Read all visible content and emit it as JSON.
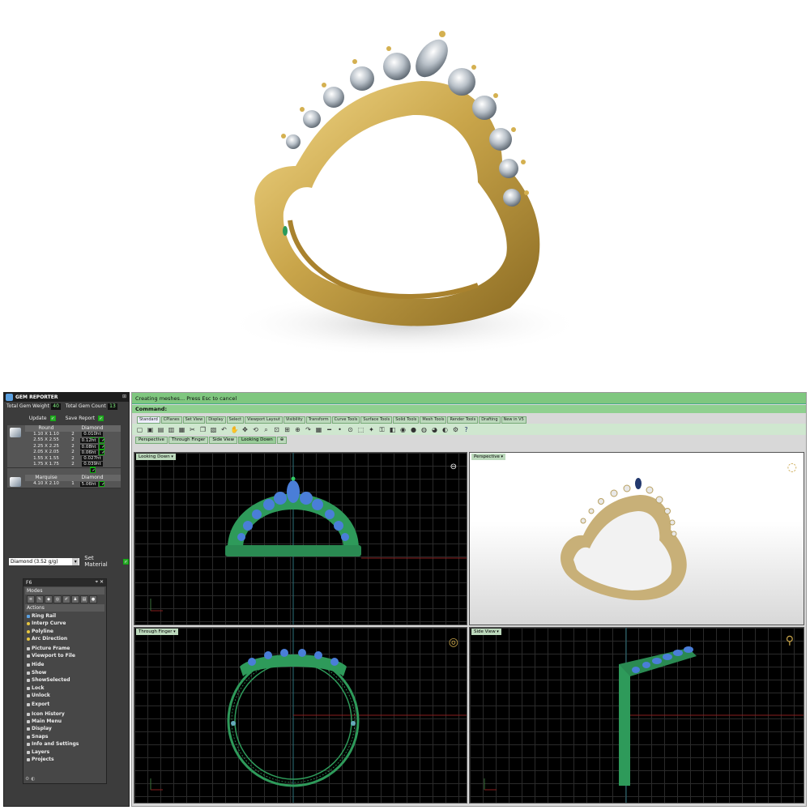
{
  "gem_reporter": {
    "title": "GEM REPORTER",
    "total_weight_label": "Total Gem Weight",
    "total_weight": "40",
    "total_count_label": "Total Gem Count",
    "total_count": "13",
    "update_label": "Update",
    "save_report_label": "Save Report",
    "groups": [
      {
        "shape": "Round",
        "material": "Diamond",
        "rows": [
          {
            "size": "1.10 X 1.10",
            "qty": "2",
            "weight": "0.010ht"
          },
          {
            "size": "2.55 X 2.55",
            "qty": "2",
            "weight": "0.12ht"
          },
          {
            "size": "2.25 X 2.25",
            "qty": "2",
            "weight": "0.08ht"
          },
          {
            "size": "2.05 X 2.05",
            "qty": "2",
            "weight": "0.06ht"
          },
          {
            "size": "1.55 X 1.55",
            "qty": "2",
            "weight": "0.027ht"
          },
          {
            "size": "1.75 X 1.75",
            "qty": "2",
            "weight": "0.039ht"
          }
        ]
      },
      {
        "shape": "Marquise",
        "material": "Diamond",
        "rows": [
          {
            "size": "4.10 X 2.10",
            "qty": "1",
            "weight": "5.06ht"
          }
        ]
      }
    ],
    "material_select": "Diamond  (3.52 g/g)",
    "set_material_label": "Set Material"
  },
  "f6": {
    "title": "F6",
    "modes_label": "Modes",
    "actions_label": "Actions",
    "actions": [
      {
        "label": "Ring Rail",
        "kind": "b"
      },
      {
        "label": "Interp Curve",
        "kind": "y"
      },
      {
        "label": "Polyline",
        "kind": "y"
      },
      {
        "label": "Arc Direction",
        "kind": "y"
      },
      {
        "label": "Picture Frame",
        "kind": "w"
      },
      {
        "label": "Viewport to File",
        "kind": "w"
      },
      {
        "label": "Hide",
        "kind": "w"
      },
      {
        "label": "Show",
        "kind": "w"
      },
      {
        "label": "ShowSelected",
        "kind": "w"
      },
      {
        "label": "Lock",
        "kind": "w"
      },
      {
        "label": "Unlock",
        "kind": "w"
      },
      {
        "label": "Export",
        "kind": "w"
      },
      {
        "label": "Icon History",
        "kind": "w"
      },
      {
        "label": "Main Menu",
        "kind": "w"
      },
      {
        "label": "Display",
        "kind": "w"
      },
      {
        "label": "Snaps",
        "kind": "w"
      },
      {
        "label": "Info and Settings",
        "kind": "w"
      },
      {
        "label": "Layers",
        "kind": "w"
      },
      {
        "label": "Projects",
        "kind": "w"
      }
    ]
  },
  "rhino": {
    "command_history": "Creating meshes... Press Esc to cancel",
    "command_label": "Command:",
    "toolbar_tabs": [
      "Standard",
      "CPlanes",
      "Set View",
      "Display",
      "Select",
      "Viewport Layout",
      "Visibility",
      "Transform",
      "Curve Tools",
      "Surface Tools",
      "Solid Tools",
      "Mesh Tools",
      "Render Tools",
      "Drafting",
      "New in V5"
    ],
    "viewport_tabs": [
      "Perspective",
      "Through Finger",
      "Side View",
      "Looking Down"
    ],
    "viewports": {
      "top_left": "Looking Down",
      "top_right": "Perspective",
      "bottom_left": "Through Finger",
      "bottom_right": "Side View"
    }
  },
  "colors": {
    "gold": "#c9a54a",
    "command_green": "#7fc77f",
    "panel_dark": "#3c3c3c",
    "model_green": "#2e9a5a",
    "gem_blue": "#4a7ed8"
  }
}
